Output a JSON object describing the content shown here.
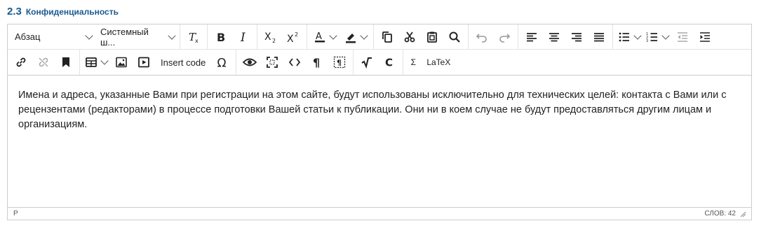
{
  "section": {
    "number": "2.3",
    "title": "Конфиденциальность"
  },
  "toolbar": {
    "block_format": "Абзац",
    "font_family": "Системный ш...",
    "insert_code_label": "Insert code",
    "sigma_label": "Σ",
    "latex_label": "LaTeX"
  },
  "content": {
    "text": "Имена и адреса, указанные Вами при регистрации на этом сайте, будут использованы исключительно для технических целей: контакта с Вами или с рецензентами (редакторами) в процессе подготовки Вашей статьи к публикации. Они ни в коем случае не будут предоставляться другим лицам и организациям."
  },
  "statusbar": {
    "path": "P",
    "word_count": "СЛОВ: 42"
  },
  "colors": {
    "accent": "#1a5a8f"
  }
}
